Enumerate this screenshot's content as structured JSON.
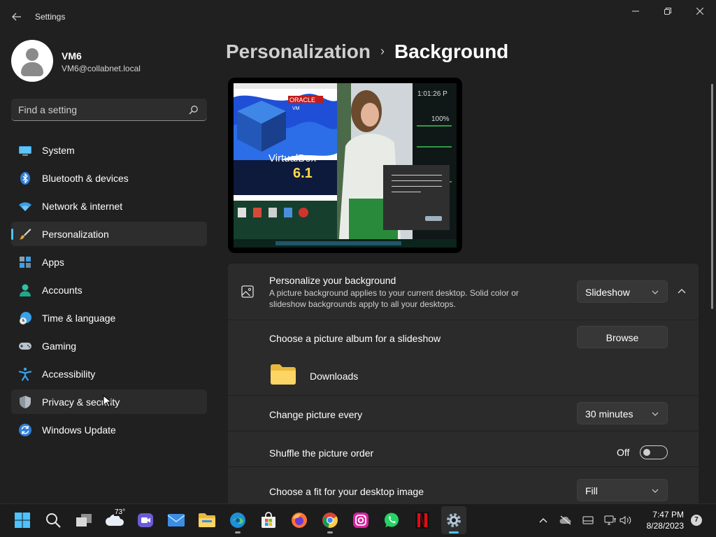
{
  "window": {
    "title": "Settings"
  },
  "profile": {
    "name": "VM6",
    "email": "VM6@collabnet.local"
  },
  "search": {
    "placeholder": "Find a setting"
  },
  "sidebar": {
    "items": [
      {
        "label": "System",
        "icon": "system-icon"
      },
      {
        "label": "Bluetooth & devices",
        "icon": "bluetooth-icon"
      },
      {
        "label": "Network & internet",
        "icon": "wifi-icon"
      },
      {
        "label": "Personalization",
        "icon": "brush-icon",
        "active": true
      },
      {
        "label": "Apps",
        "icon": "apps-icon"
      },
      {
        "label": "Accounts",
        "icon": "person-icon"
      },
      {
        "label": "Time & language",
        "icon": "globe-clock-icon"
      },
      {
        "label": "Gaming",
        "icon": "gamepad-icon"
      },
      {
        "label": "Accessibility",
        "icon": "accessibility-icon"
      },
      {
        "label": "Privacy & security",
        "icon": "shield-icon"
      },
      {
        "label": "Windows Update",
        "icon": "update-icon"
      }
    ]
  },
  "breadcrumb": {
    "parent": "Personalization",
    "separator": "›",
    "current": "Background"
  },
  "preview": {
    "wallpaper_text": "VirtualBox",
    "wallpaper_version": "6.1",
    "wallpaper_brand": "ORACLE",
    "wallpaper_sub": "VM",
    "clock_text": "1:01:26 P",
    "percent_text": "100%"
  },
  "background": {
    "title": "Personalize your background",
    "description": "A picture background applies to your current desktop. Solid color or slideshow backgrounds apply to all your desktops.",
    "type_value": "Slideshow"
  },
  "album": {
    "title": "Choose a picture album for a slideshow",
    "browse_label": "Browse",
    "folder_name": "Downloads"
  },
  "interval": {
    "title": "Change picture every",
    "value": "30 minutes"
  },
  "shuffle": {
    "title": "Shuffle the picture order",
    "state": "Off"
  },
  "fit": {
    "title": "Choose a fit for your desktop image",
    "value": "Fill"
  },
  "taskbar": {
    "weather_temp": "73°",
    "time": "7:47 PM",
    "date": "8/28/2023",
    "notification_count": "7"
  },
  "colors": {
    "accent": "#4cc2ff",
    "background": "#202020",
    "card": "#2b2b2b"
  }
}
